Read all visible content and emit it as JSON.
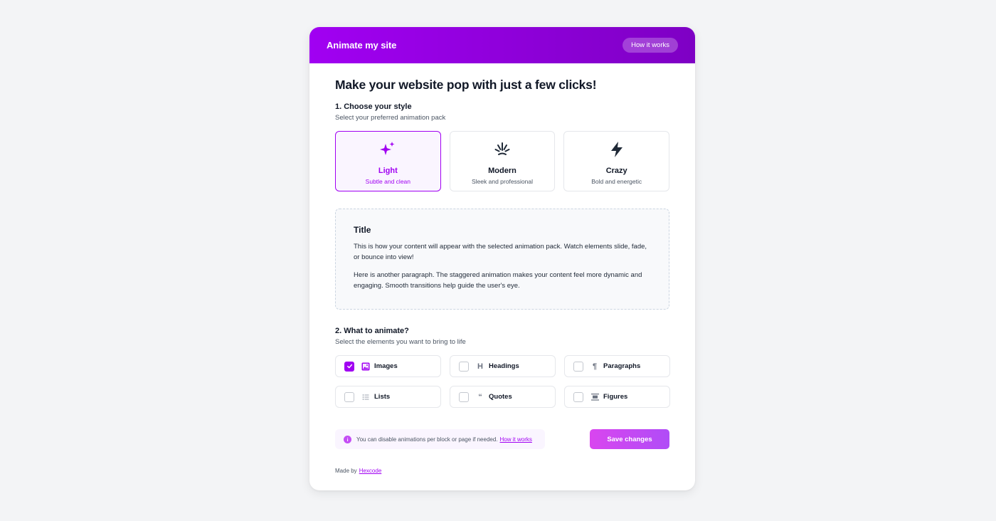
{
  "header": {
    "title": "Animate my site",
    "how_it_works": "How it works"
  },
  "main": {
    "title": "Make your website pop with just a few clicks!",
    "section1": {
      "title": "1. Choose your style",
      "subtitle": "Select your preferred animation pack"
    },
    "packs": [
      {
        "name": "Light",
        "desc": "Subtle and clean",
        "icon": "sparkles-icon",
        "selected": true
      },
      {
        "name": "Modern",
        "desc": "Sleek and professional",
        "icon": "burst-icon",
        "selected": false
      },
      {
        "name": "Crazy",
        "desc": "Bold and energetic",
        "icon": "lightning-icon",
        "selected": false
      }
    ],
    "preview": {
      "title": "Title",
      "paragraph1": "This is how your content will appear with the selected animation pack. Watch elements slide, fade, or bounce into view!",
      "paragraph2": "Here is another paragraph. The staggered animation makes your content feel more dynamic and engaging. Smooth transitions help guide the user's eye."
    },
    "section2": {
      "title": "2. What to animate?",
      "subtitle": "Select the elements you want to bring to life"
    },
    "elements": [
      {
        "label": "Images",
        "icon": "image-icon",
        "checked": true
      },
      {
        "label": "Headings",
        "icon": "heading-icon",
        "checked": false
      },
      {
        "label": "Paragraphs",
        "icon": "pilcrow-icon",
        "checked": false
      },
      {
        "label": "Lists",
        "icon": "list-icon",
        "checked": false
      },
      {
        "label": "Quotes",
        "icon": "quote-icon",
        "checked": false
      },
      {
        "label": "Figures",
        "icon": "figure-icon",
        "checked": false
      }
    ],
    "note": {
      "text": "You can disable animations per block or page if needed.",
      "link": "How it works"
    },
    "save_label": "Save changes",
    "made_by": {
      "text": "Made by",
      "link": "Hexcode"
    }
  },
  "colors": {
    "accent": "#a100f2",
    "header_gradient_start": "#a100f2",
    "header_gradient_end": "#7e00c4",
    "button_gradient_start": "#d946ef",
    "button_gradient_end": "#b04cf7"
  }
}
